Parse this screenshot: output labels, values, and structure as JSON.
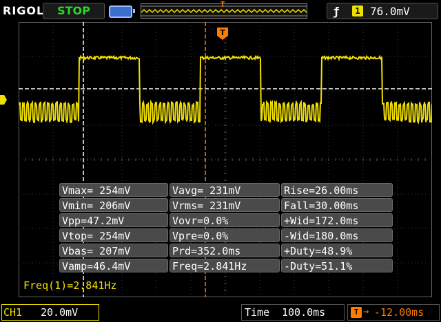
{
  "header": {
    "brand": "RIGOL",
    "run_state": "STOP",
    "trigger_marker": "T",
    "trigger_channel": "1",
    "trigger_level": "76.0mV"
  },
  "screen_markers": {
    "trigger_flag": "T"
  },
  "measurements": [
    [
      "Vmax= 254mV",
      "Vavg= 231mV",
      "Rise=26.00ms"
    ],
    [
      "Vmin= 206mV",
      "Vrms= 231mV",
      "Fall=30.00ms"
    ],
    [
      "Vpp=47.2mV",
      "Vovr=0.0%",
      "+Wid=172.0ms"
    ],
    [
      "Vtop= 254mV",
      "Vpre=0.0%",
      "-Wid=180.0ms"
    ],
    [
      "Vbas= 207mV",
      "Prd=352.0ms",
      "+Duty=48.9%"
    ],
    [
      "Vamp=46.4mV",
      "Freq=2.841Hz",
      "-Duty=51.1%"
    ]
  ],
  "frequency_readout": "Freq(1)=2.841Hz",
  "footer": {
    "channel_label": "CH1",
    "channel_scale": "20.0mV",
    "time_label": "Time",
    "time_scale": "100.0ms",
    "trigger_offset_icon": "T",
    "trigger_offset_arrow": "→",
    "trigger_offset": "-12.00ms"
  },
  "colors": {
    "trace": "#f0e000",
    "trigger": "#ff7b00",
    "run_state": "#2bd62b",
    "grid": "#3c3c3c"
  },
  "icons": {
    "battery": "battery-icon",
    "edge": "rising-edge-icon"
  }
}
